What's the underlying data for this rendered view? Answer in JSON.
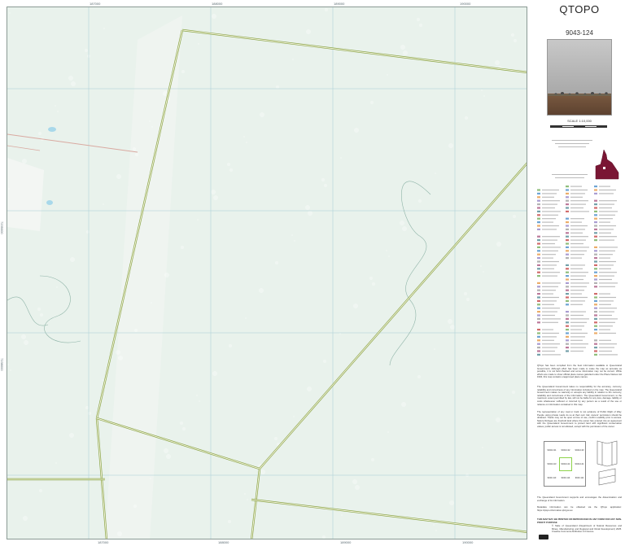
{
  "map": {
    "colors": {
      "vegetation": "#e9f2ec",
      "grid": "#a7cdd4",
      "road": "#8aa64a",
      "road_fill": "#f4f1dc",
      "track": "#d9a9a0",
      "water": "#a8d8ea",
      "cleared": "#f4f6f4"
    },
    "grid_labels_top": [
      "187000",
      "188000",
      "189000",
      "190000",
      "191000"
    ],
    "grid_labels_bottom": [
      "187000",
      "188000",
      "189000",
      "190000",
      "191000"
    ],
    "grid_labels_left": [
      "7240000",
      "7239000",
      "7238000"
    ]
  },
  "panel": {
    "title": "QTOPO",
    "sheet": "9043-124",
    "scale": "SCALE 1:10,000",
    "paragraph_1": "QTopo has been compiled from the best information available to Queensland Government. Although effort has been made to make the map as accurate as possible, it is not field checked and some information may not be current. While efforts are made to show official place names gazetted under the Place Names Act 1994, this map contains unapproved place names.",
    "paragraph_2": "The Queensland Government takes no responsibility for the accuracy, currency, reliability and correctness of any information included on the map. The Queensland Government makes no warranty or accepts any liability in relation to the currency, reliability and correctness of the information. The Queensland Government, to the maximum extent permitted by law, will not be liable for any loss, damage, liability or costs whatsoever suffered or incurred by any person as a result of the use or reliance on information contained in this map.",
    "paragraph_3": "The representation of any road or track is not evidence of Public Right of Way. People using private roads do so at their own risk; owners' permission should be obtained. Tracks may not be open at time of use, confirm usability prior to access. Nature Refuges are freehold land where the owner has entered into an agreement with the Queensland Government to protect land with significant conservation values; public access is not allowed, except with the permission of the owner.",
    "paragraph_4": "The Queensland Government supports and encourages the dissemination and exchange of its information.",
    "paragraph_5": "Metadata information can be obtained via the QTopo application: https://qtopo.information.qld.gov.au",
    "notice": "THIS MAP MAY BE PRINTED OR REPRODUCED IN ANY FORM FOR ANY NON-PROFIT PURPOSE",
    "copyright": "© State of Queensland (Department of Natural Resources and Mines, Manufacturing and Regional and Rural Development) 2025. Creative Commons Attribution 4.0 licence.",
    "index_sheets": [
      "9043-131",
      "9043-132",
      "9043-133",
      "9043-123",
      "9043-124",
      "9043-121",
      "9043-113",
      "9043-114",
      "9043-111"
    ]
  }
}
